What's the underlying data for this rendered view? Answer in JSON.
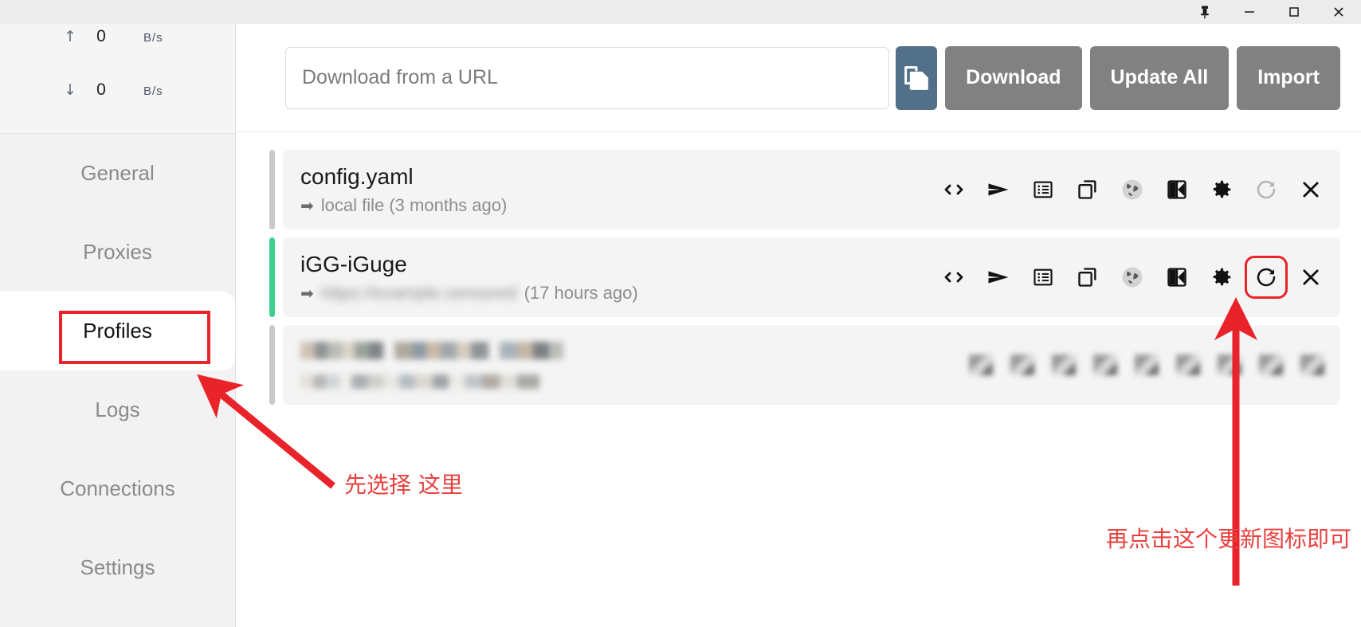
{
  "window": {
    "controls": [
      {
        "name": "pin-icon",
        "label": "Pin"
      },
      {
        "name": "minimize-icon",
        "label": "Minimize"
      },
      {
        "name": "maximize-icon",
        "label": "Maximize"
      },
      {
        "name": "close-icon",
        "label": "Close"
      }
    ]
  },
  "sidebar": {
    "speed": {
      "upload": {
        "arrow": "↑",
        "value": "0",
        "unit": "B/s"
      },
      "download": {
        "arrow": "↓",
        "value": "0",
        "unit": "B/s"
      }
    },
    "items": [
      {
        "label": "General",
        "active": false
      },
      {
        "label": "Proxies",
        "active": false
      },
      {
        "label": "Profiles",
        "active": true
      },
      {
        "label": "Logs",
        "active": false
      },
      {
        "label": "Connections",
        "active": false
      },
      {
        "label": "Settings",
        "active": false
      }
    ]
  },
  "toolbar": {
    "url_placeholder": "Download from a URL",
    "url_value": "",
    "paste_icon": "clipboard-copy-icon",
    "download_label": "Download",
    "update_all_label": "Update All",
    "import_label": "Import"
  },
  "profiles": {
    "rows": [
      {
        "title": "config.yaml",
        "subtitle": "local file (3 months ago)",
        "source_censored": false,
        "status_color": "#c9c9c9",
        "refresh_enabled": false,
        "censored": false
      },
      {
        "title": "iGG-iGuge",
        "subtitle": "(17 hours ago)",
        "source_censored": true,
        "source_masked_text": "https://example.censored",
        "status_color": "#3ecf8e",
        "refresh_enabled": true,
        "censored": false
      },
      {
        "title": "",
        "subtitle": "",
        "source_censored": true,
        "status_color": "#c9c9c9",
        "refresh_enabled": false,
        "censored": true
      }
    ],
    "actions": [
      {
        "name": "code-icon",
        "title": "Edit as code"
      },
      {
        "name": "send-icon",
        "title": "Send"
      },
      {
        "name": "list-icon",
        "title": "Rules"
      },
      {
        "name": "copy-icon",
        "title": "Duplicate"
      },
      {
        "name": "globe-icon",
        "title": "Open link"
      },
      {
        "name": "split-view-icon",
        "title": "Compare"
      },
      {
        "name": "gear-icon",
        "title": "Settings"
      },
      {
        "name": "refresh-icon",
        "title": "Update"
      },
      {
        "name": "close-icon",
        "title": "Delete"
      }
    ]
  },
  "annotations": {
    "select_here": "先选择 这里",
    "click_update": "再点击这个更新图标即可",
    "accent_color": "#e8242a"
  }
}
